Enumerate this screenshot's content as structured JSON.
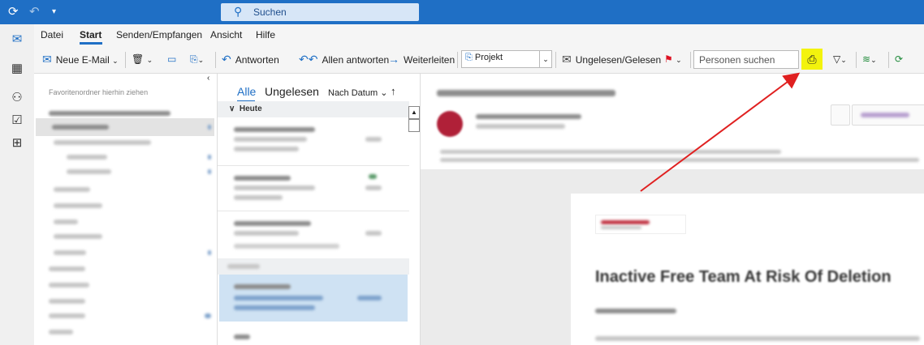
{
  "titlebar": {
    "sync_icon": "sync-icon",
    "undo_icon": "undo-icon",
    "quick_access_icon": "dropdown-icon",
    "search_placeholder": "Suchen"
  },
  "menu": {
    "items": [
      "Datei",
      "Start",
      "Senden/Empfangen",
      "Ansicht",
      "Hilfe"
    ]
  },
  "ribbon": {
    "new_email": "Neue E-Mail",
    "reply": "Antworten",
    "reply_all": "Allen antworten",
    "forward": "Weiterleiten",
    "project": "Projekt",
    "unread_read": "Ungelesen/Gelesen",
    "people_search": "Personen suchen"
  },
  "folders": {
    "favorites_hint": "Favoritenordner hierhin ziehen"
  },
  "maillist": {
    "tab_all": "Alle",
    "tab_unread": "Ungelesen",
    "sort": "Nach Datum",
    "group_today": "Heute",
    "collapse_glyph": "∨"
  },
  "reading": {
    "heading": "Inactive Free Team At Risk Of Deletion"
  },
  "colors": {
    "accent": "#1f6fc5",
    "highlight": "#f3f30d",
    "arrow": "#e02020"
  }
}
